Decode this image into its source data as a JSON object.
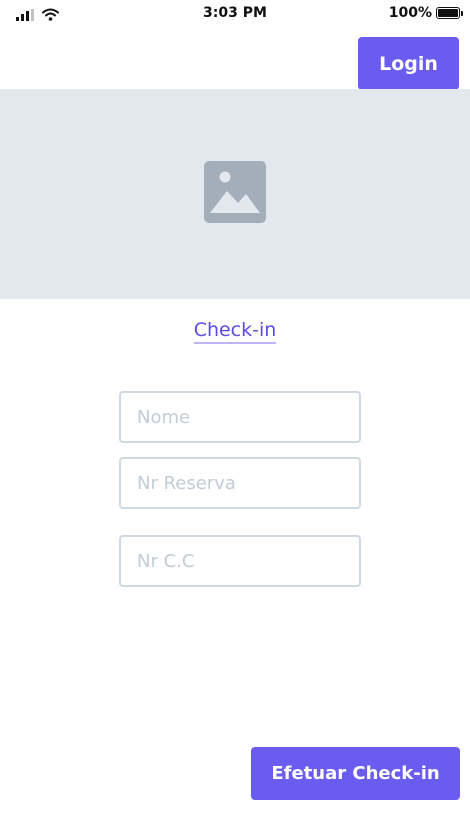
{
  "status_bar": {
    "time": "3:03 PM",
    "battery_text": "100%",
    "signal_icon": "cellular-signal-icon",
    "wifi_icon": "wifi-icon",
    "battery_icon": "battery-full-icon"
  },
  "header": {
    "login_label": "Login"
  },
  "hero": {
    "icon": "image-placeholder-icon"
  },
  "checkin_link": {
    "label": "Check-in"
  },
  "form": {
    "fields": [
      {
        "placeholder": "Nome",
        "value": ""
      },
      {
        "placeholder": "Nr Reserva",
        "value": ""
      },
      {
        "placeholder": "Nr C.C",
        "value": ""
      }
    ],
    "submit_label": "Efetuar Check-in"
  },
  "colors": {
    "accent": "#6b5cf0",
    "link": "#5a4ce3",
    "hero_bg": "#e3e8ee",
    "field_border": "#cfd7e0",
    "placeholder": "#c3ccd6"
  }
}
